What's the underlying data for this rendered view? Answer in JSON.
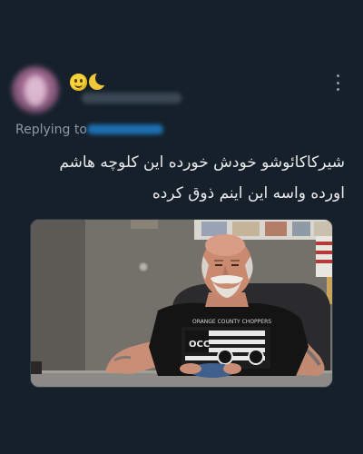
{
  "tweet": {
    "replying_to_label": "Replying to",
    "text_lines": [
      "شیرکاکائوشو خودش خورده این کلوچه هاشم",
      "اورده واسه این اینم ذوق کرده"
    ]
  },
  "icons": {
    "emoji_1": "smiling-face-emoji",
    "emoji_2": "crescent-moon-emoji",
    "more": "vertical-ellipsis-icon"
  },
  "media": {
    "shirt_text": "ORANGE COUNTY CHOPPERS",
    "shirt_logo": "OCC"
  },
  "colors": {
    "background": "#15202b",
    "text": "#e7e9ea",
    "secondary_text": "#8b98a5"
  }
}
